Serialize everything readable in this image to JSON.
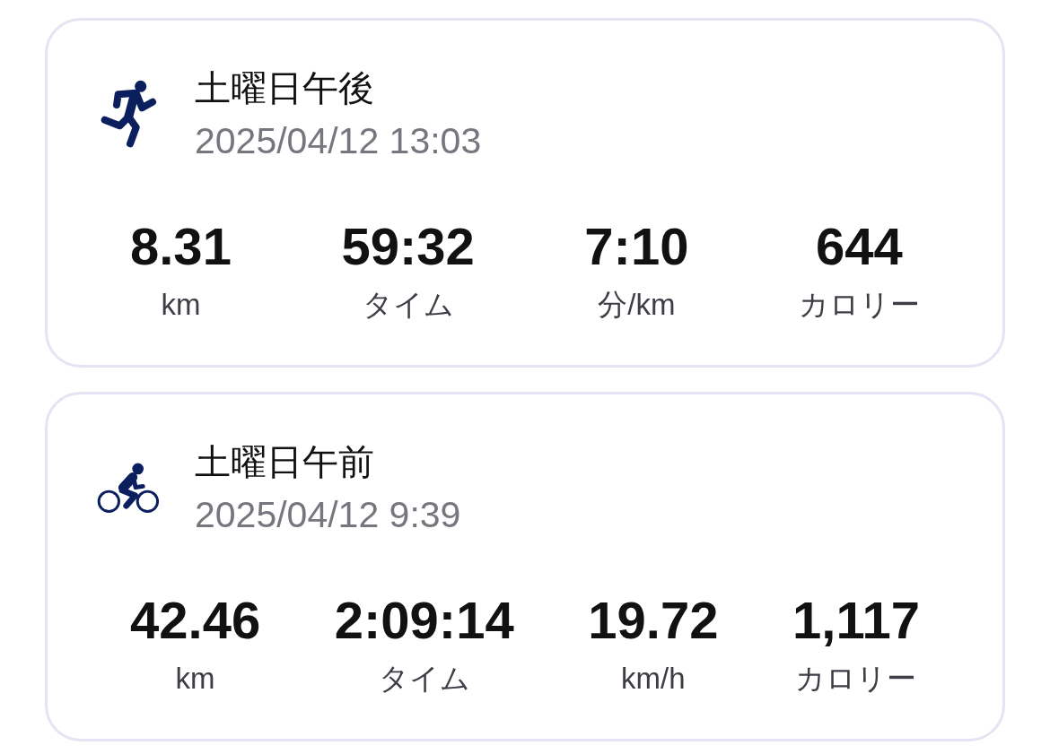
{
  "activities": [
    {
      "kind": "run",
      "title": "土曜日午後",
      "datetime": "2025/04/12 13:03",
      "stats": [
        {
          "value": "8.31",
          "label": "km"
        },
        {
          "value": "59:32",
          "label": "タイム"
        },
        {
          "value": "7:10",
          "label": "分/km"
        },
        {
          "value": "644",
          "label": "カロリー"
        }
      ]
    },
    {
      "kind": "bike",
      "title": "土曜日午前",
      "datetime": "2025/04/12 9:39",
      "stats": [
        {
          "value": "42.46",
          "label": "km"
        },
        {
          "value": "2:09:14",
          "label": "タイム"
        },
        {
          "value": "19.72",
          "label": "km/h"
        },
        {
          "value": "1,117",
          "label": "カロリー"
        }
      ]
    }
  ]
}
